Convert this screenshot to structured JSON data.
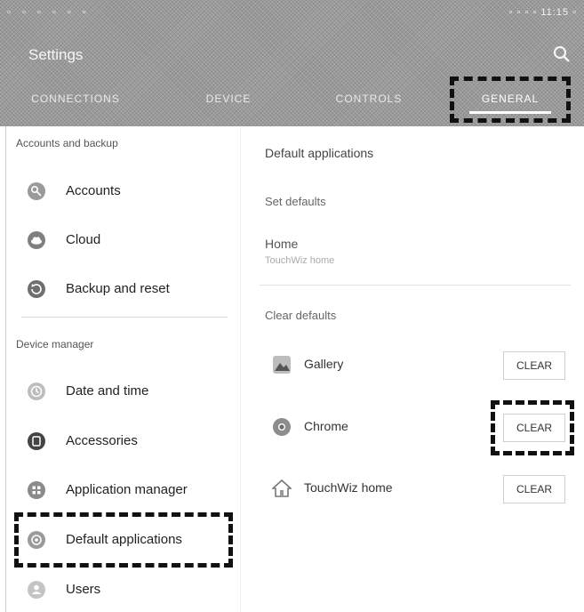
{
  "header": {
    "title": "Settings",
    "status_left": "▫ ▫ ▫ ▫ ▫ ▫",
    "status_right": "▫ ▫ ▫ ▫ 11:15 ▫"
  },
  "tabs": [
    {
      "label": "CONNECTIONS",
      "active": false
    },
    {
      "label": "DEVICE",
      "active": false
    },
    {
      "label": "CONTROLS",
      "active": false
    },
    {
      "label": "GENERAL",
      "active": true
    }
  ],
  "left": {
    "section1_title": "Accounts and backup",
    "items1": [
      {
        "label": "Accounts",
        "icon": "key-icon"
      },
      {
        "label": "Cloud",
        "icon": "cloud-icon"
      },
      {
        "label": "Backup and reset",
        "icon": "backup-icon"
      }
    ],
    "section2_title": "Device manager",
    "items2": [
      {
        "label": "Date and time",
        "icon": "clock-icon"
      },
      {
        "label": "Accessories",
        "icon": "accessories-icon"
      },
      {
        "label": "Application manager",
        "icon": "apps-icon"
      },
      {
        "label": "Default applications",
        "icon": "default-apps-icon",
        "selected": true
      },
      {
        "label": "Users",
        "icon": "users-icon"
      }
    ]
  },
  "right": {
    "title": "Default applications",
    "set_defaults": "Set defaults",
    "home_label": "Home",
    "home_value": "TouchWiz home",
    "clear_defaults": "Clear defaults",
    "apps": [
      {
        "label": "Gallery",
        "icon": "gallery-icon",
        "button": "CLEAR"
      },
      {
        "label": "Chrome",
        "icon": "chrome-icon",
        "button": "CLEAR"
      },
      {
        "label": "TouchWiz home",
        "icon": "home-icon",
        "button": "CLEAR"
      }
    ]
  },
  "colors": {
    "header_bg": "#9a9a9a",
    "highlight": "#111111"
  }
}
